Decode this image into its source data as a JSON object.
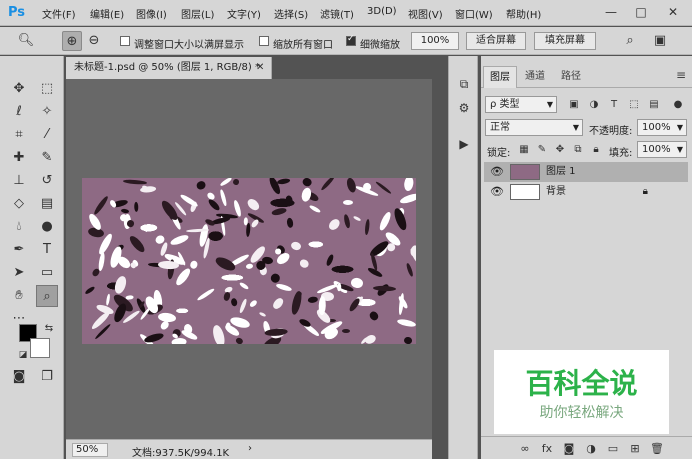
{
  "app": {
    "logo": "Ps"
  },
  "menu": [
    "文件(F)",
    "编辑(E)",
    "图像(I)",
    "图层(L)",
    "文字(Y)",
    "选择(S)",
    "滤镜(T)",
    "3D(D)",
    "视图(V)",
    "窗口(W)",
    "帮助(H)"
  ],
  "window_controls": {
    "minimize": "—",
    "restore": "□",
    "close": "✕"
  },
  "options": {
    "resize_windows_label": "调整窗口大小以满屏显示",
    "resize_windows_checked": false,
    "zoom_all_label": "缩放所有窗口",
    "zoom_all_checked": false,
    "scrubby_zoom_label": "细微缩放",
    "scrubby_zoom_checked": true,
    "zoom_value": "100%",
    "fit_screen_label": "适合屏幕",
    "fill_screen_label": "填充屏幕"
  },
  "document": {
    "tab_title": "未标题-1.psd @ 50% (图层 1, RGB/8) *",
    "close": "✕",
    "zoom": "50%",
    "info": "文档:937.5K/994.1K",
    "status_arrow": "›"
  },
  "layers_panel": {
    "tabs": [
      "图层",
      "通道",
      "路径"
    ],
    "filter_kind": "ρ 类型",
    "blend_mode": "正常",
    "opacity_label": "不透明度:",
    "opacity_value": "100%",
    "lock_label": "锁定:",
    "fill_label": "填充:",
    "fill_value": "100%",
    "layers": [
      {
        "name": "图层 1",
        "selected": true,
        "locked": false
      },
      {
        "name": "背景",
        "selected": false,
        "locked": true
      }
    ]
  },
  "watermark": {
    "title": "百科全说",
    "subtitle": "助你轻松解决"
  },
  "colors": {
    "accent": "#1a8fe3",
    "foreground": "#000000",
    "background": "#ffffff",
    "texture": "#8e6a84"
  }
}
